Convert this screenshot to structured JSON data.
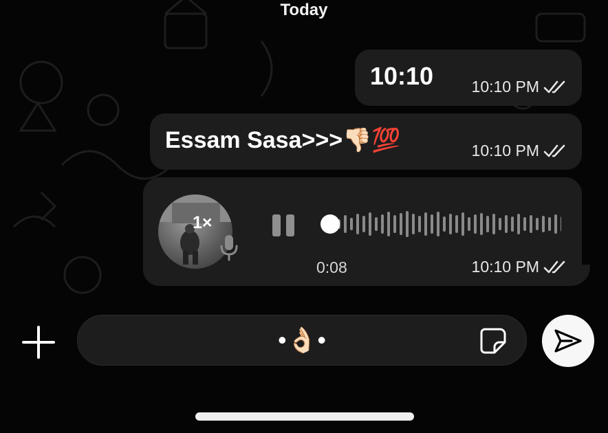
{
  "header": {
    "date_label": "Today"
  },
  "messages": [
    {
      "text": "10:10",
      "time": "10:10 PM",
      "status": "double-check-icon"
    },
    {
      "text": "Essam Sasa>>>",
      "emoji_1": "👎🏻",
      "emoji_2": "💯",
      "time": "10:10 PM",
      "status": "double-check-icon"
    }
  ],
  "voice_message": {
    "speed": "1×",
    "duration": "0:08",
    "time": "10:10 PM",
    "status": "double-check-icon",
    "progress": 0.0
  },
  "composer": {
    "text": "•👌🏻•",
    "plus_icon": "plus-icon",
    "sticker_icon": "sticker-icon",
    "send_icon": "send-icon"
  },
  "colors": {
    "background": "#050505",
    "bubble": "#1d1d1e",
    "text": "#ffffff",
    "send_button": "#f7f7f7"
  }
}
